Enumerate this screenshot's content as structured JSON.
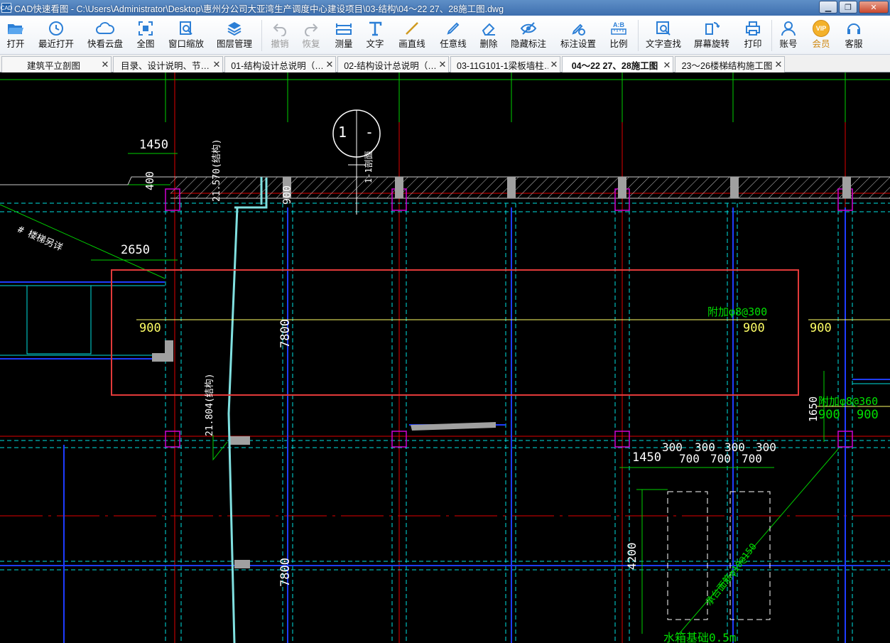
{
  "window": {
    "title": "CAD快速看图 - C:\\Users\\Administrator\\Desktop\\惠州分公司大亚湾生产调度中心建设项目\\03-结构\\04～22 27、28施工图.dwg",
    "app_icon_text": "CAD"
  },
  "toolbar": {
    "items": [
      {
        "label": "打开",
        "icon": "folder-open-icon"
      },
      {
        "label": "最近打开",
        "icon": "recent-icon"
      },
      {
        "label": "快看云盘",
        "icon": "cloud-icon"
      },
      {
        "label": "全图",
        "icon": "fit-all-icon"
      },
      {
        "label": "窗口缩放",
        "icon": "window-zoom-icon"
      },
      {
        "label": "图层管理",
        "icon": "layers-icon"
      },
      {
        "label": "撤销",
        "icon": "undo-icon",
        "disabled": true
      },
      {
        "label": "恢复",
        "icon": "redo-icon",
        "disabled": true
      },
      {
        "label": "测量",
        "icon": "measure-icon"
      },
      {
        "label": "文字",
        "icon": "text-icon"
      },
      {
        "label": "画直线",
        "icon": "line-icon"
      },
      {
        "label": "任意线",
        "icon": "pen-icon"
      },
      {
        "label": "删除",
        "icon": "eraser-icon"
      },
      {
        "label": "隐藏标注",
        "icon": "eye-hidden-icon"
      },
      {
        "label": "标注设置",
        "icon": "annotation-settings-icon"
      },
      {
        "label": "比例",
        "icon": "scale-icon"
      },
      {
        "label": "文字查找",
        "icon": "text-search-icon"
      },
      {
        "label": "屏幕旋转",
        "icon": "rotate-icon"
      },
      {
        "label": "打印",
        "icon": "printer-icon"
      },
      {
        "label": "账号",
        "icon": "user-icon"
      },
      {
        "label": "会员",
        "icon": "vip-icon"
      },
      {
        "label": "客服",
        "icon": "headset-icon"
      }
    ],
    "vip_badge": "VIP",
    "scale_badge": "A:B"
  },
  "tabs": [
    {
      "label": "建筑平立剖图",
      "active": false
    },
    {
      "label": "目录、设计说明、节…",
      "active": false
    },
    {
      "label": "01-结构设计总说明（…",
      "active": false
    },
    {
      "label": "02-结构设计总说明（…",
      "active": false
    },
    {
      "label": "03-11G101-1梁板墙柱…",
      "active": false
    },
    {
      "label": "04～22 27、28施工图",
      "active": true
    },
    {
      "label": "23～26楼梯结构施工图",
      "active": false
    }
  ],
  "drawing": {
    "texts": {
      "dim_1450_top": "1450",
      "dim_400": "400",
      "dim_900_a": "900",
      "elev_1": "21.570(结构)",
      "elev_2": "21.804(结构)",
      "stair_note": "# 楼梯另详",
      "dim_2650": "2650",
      "dim_900_left": "900",
      "dim_7800_a": "7800",
      "rebar_1": "附加φ8@300",
      "dim_900_mid": "900",
      "dim_900_right": "900",
      "rebar_2": "附加φ8@360",
      "dim_900_r1": "900",
      "dim_900_r2": "900",
      "dim_1650": "1650",
      "dim_1450_b": "1450",
      "dim_300_a": "300",
      "dim_300_b": "300",
      "dim_300_c": "300",
      "dim_300_d": "300",
      "dim_700_a": "700",
      "dim_700_b": "700",
      "dim_700_c": "700",
      "dim_4200": "4200",
      "dim_7800_b": "7800",
      "rebar_diag": "承台面筋φ10@150",
      "water_tank": "水箱基础0.5m",
      "section_mark": "1",
      "section_sub": "-",
      "section_label": "1-1剖面"
    },
    "colors": {
      "grid_green": "#00d000",
      "axis_red": "#e00000",
      "beam_cyan": "#00e0e0",
      "column_magenta": "#d000d0",
      "wall_blue": "#1e3cff",
      "text_white": "#ffffff",
      "text_yellow": "#ffff66",
      "highlight_red": "#e23a3a"
    }
  }
}
